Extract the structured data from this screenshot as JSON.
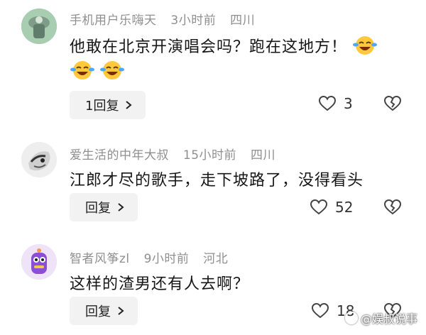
{
  "comments": [
    {
      "username": "手机用户乐嗨天",
      "time": "3小时前",
      "location": "四川",
      "text": "他敢在北京开演唱会吗？跑在这地方！",
      "reply_label": "1回复",
      "likes": "3",
      "avatar_icon": "hat-avatar",
      "emojis": [
        "laughing-crying-emoji",
        "laughing-crying-emoji",
        "laughing-crying-emoji"
      ]
    },
    {
      "username": "爱生活的中年大叔",
      "time": "15小时前",
      "location": "四川",
      "text": "江郎才尽的歌手，走下坡路了，没得看头",
      "reply_label": "回复",
      "likes": "52",
      "avatar_icon": "ink-sketch-avatar"
    },
    {
      "username": "智者风筝zl",
      "time": "9小时前",
      "location": "河北",
      "text": "这样的渣男还有人去啊？",
      "reply_label": "回复",
      "likes": "18",
      "avatar_icon": "purple-creature-avatar"
    }
  ],
  "watermark": "@娱叔说事",
  "colors": {
    "meta": "#8f8f8f",
    "reply_bg": "#f2f2f2",
    "text": "#161616"
  }
}
